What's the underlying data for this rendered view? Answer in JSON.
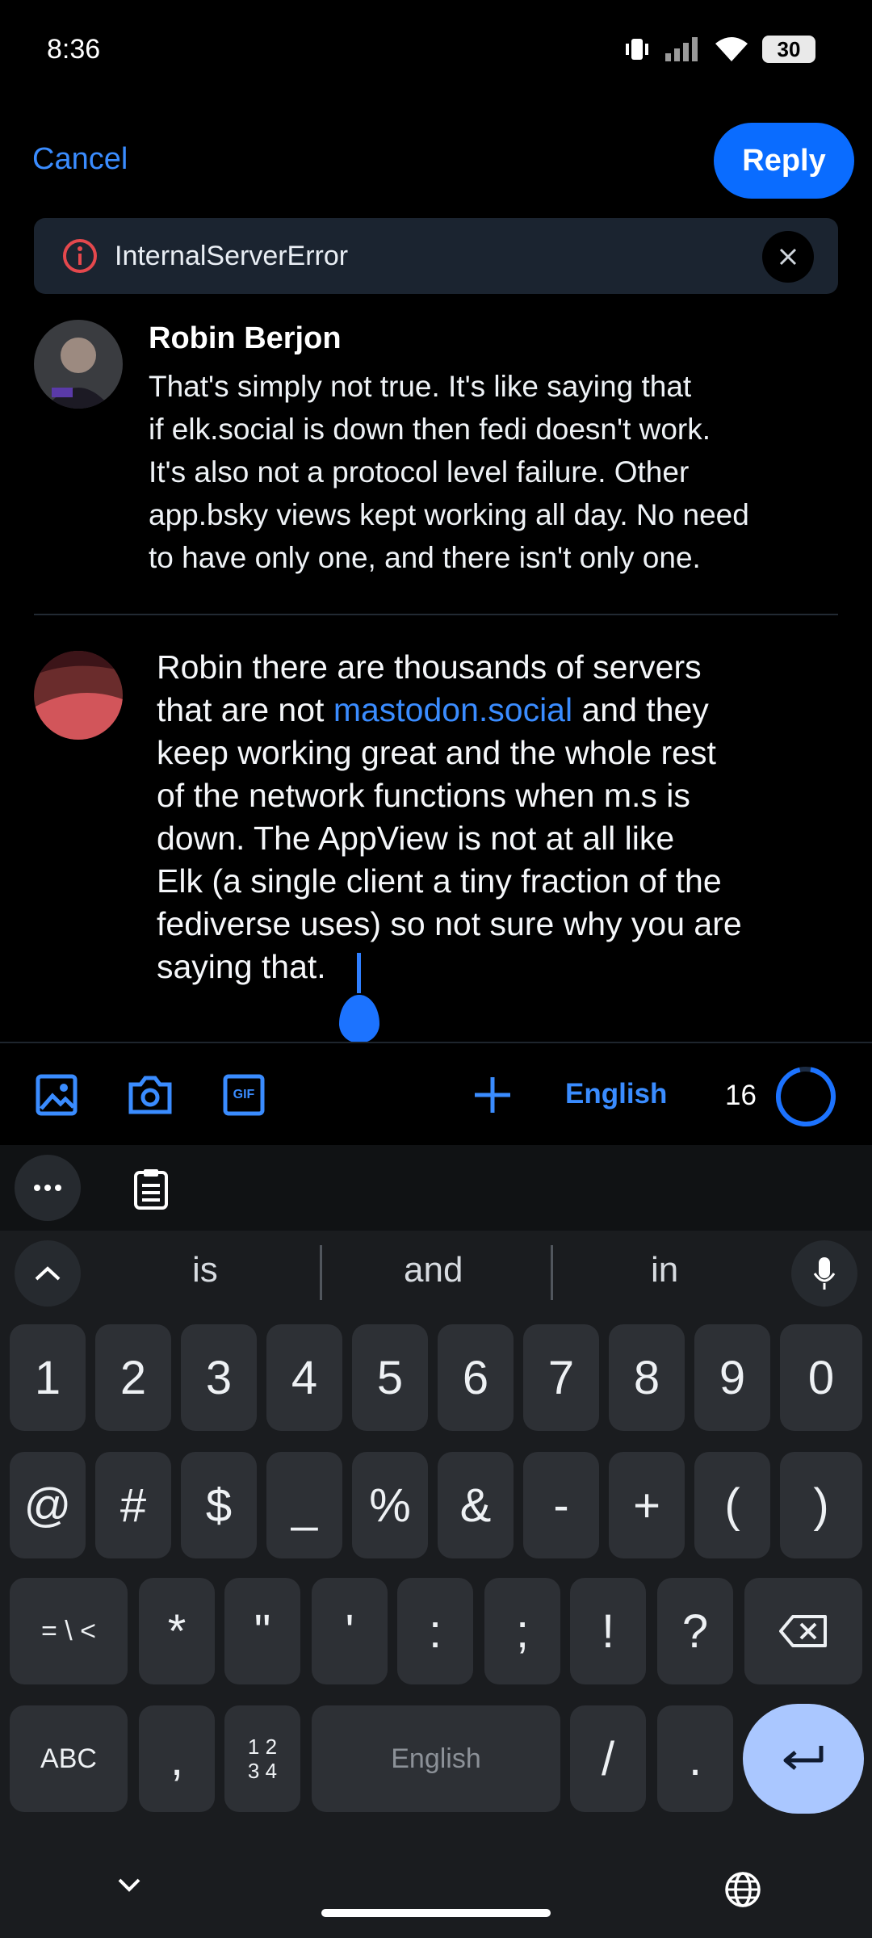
{
  "status": {
    "time": "8:36",
    "battery": "30"
  },
  "header": {
    "cancel_label": "Cancel",
    "reply_label": "Reply"
  },
  "error": {
    "message": "InternalServerError"
  },
  "replied_post": {
    "author": "Robin Berjon",
    "lines": [
      "That's simply not true. It's like saying that",
      "if elk.social is down then fedi doesn't work.",
      "It's also not a protocol level failure. Other",
      "app.bsky views kept working all day. No need",
      "to have only one, and there isn't only one."
    ]
  },
  "composer": {
    "line1": "Robin there are thousands of servers",
    "line2_pre": "that are not ",
    "line2_link": "mastodon.social",
    "line2_post": " and they",
    "line3": "keep working great and the whole rest",
    "line4": "of the network functions when m.s is",
    "line5": "down. The AppView is not at all like",
    "line6": "Elk (a single client a tiny fraction of the",
    "line7": "fediverse uses) so not sure why you are",
    "line8": "saying that. "
  },
  "toolbar": {
    "language": "English",
    "remaining_chars": "16",
    "gif_label": "GIF"
  },
  "keyboard": {
    "suggestions": [
      "is",
      "and",
      "in"
    ],
    "row1": [
      "1",
      "2",
      "3",
      "4",
      "5",
      "6",
      "7",
      "8",
      "9",
      "0"
    ],
    "row2": [
      "@",
      "#",
      "$",
      "_",
      "%",
      "&",
      "-",
      "+",
      "(",
      ")"
    ],
    "row3": [
      "= \\ <",
      "*",
      "\"",
      "'",
      ":",
      ";",
      "!",
      "?"
    ],
    "row4": {
      "abc": "ABC",
      "comma": ",",
      "numpad": "1 2\n3 4",
      "space": "English",
      "slash": "/",
      "period": "."
    }
  },
  "colors": {
    "accent": "#0a6cff",
    "link": "#3a8cff",
    "error": "#e5484d",
    "enter": "#aac7ff"
  }
}
